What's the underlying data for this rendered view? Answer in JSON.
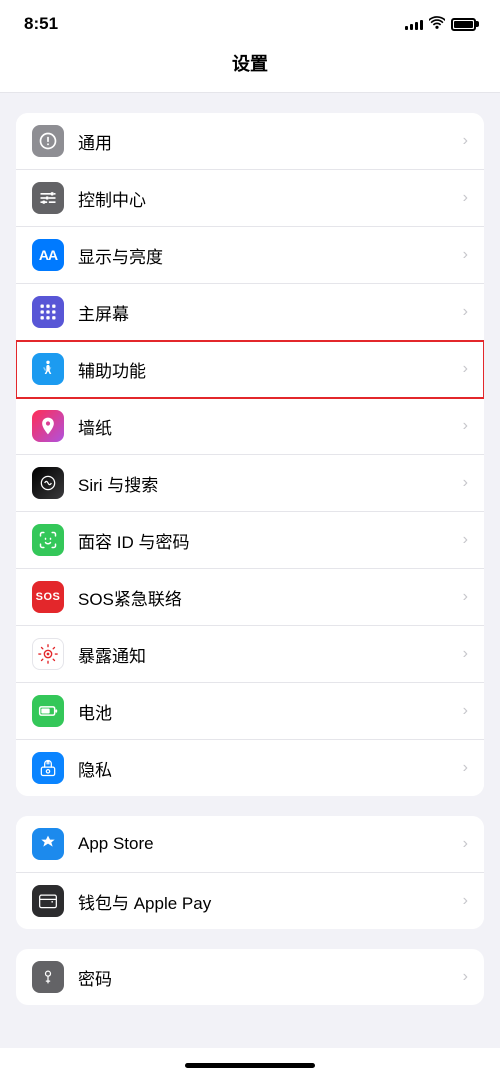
{
  "statusBar": {
    "time": "8:51",
    "signalBars": [
      4,
      6,
      8,
      10,
      12
    ],
    "batteryFull": true
  },
  "header": {
    "title": "设置"
  },
  "sections": [
    {
      "id": "section1",
      "rows": [
        {
          "id": "general",
          "label": "通用",
          "iconBg": "icon-gray",
          "icon": "gear"
        },
        {
          "id": "control-center",
          "label": "控制中心",
          "iconBg": "icon-gray2",
          "icon": "sliders"
        },
        {
          "id": "display",
          "label": "显示与亮度",
          "iconBg": "icon-blue",
          "icon": "aa"
        },
        {
          "id": "home-screen",
          "label": "主屏幕",
          "iconBg": "icon-purple",
          "icon": "grid"
        },
        {
          "id": "accessibility",
          "label": "辅助功能",
          "iconBg": "icon-blue2",
          "icon": "accessibility",
          "highlighted": true
        },
        {
          "id": "wallpaper",
          "label": "墙纸",
          "iconBg": "icon-pink",
          "icon": "flower"
        },
        {
          "id": "siri",
          "label": "Siri 与搜索",
          "iconBg": "icon-gray",
          "icon": "siri"
        },
        {
          "id": "faceid",
          "label": "面容 ID 与密码",
          "iconBg": "icon-green",
          "icon": "faceid"
        },
        {
          "id": "sos",
          "label": "SOS紧急联络",
          "iconBg": "icon-red",
          "icon": "sos"
        },
        {
          "id": "exposure",
          "label": "暴露通知",
          "iconBg": "icon-red",
          "icon": "exposure"
        },
        {
          "id": "battery",
          "label": "电池",
          "iconBg": "icon-green",
          "icon": "battery"
        },
        {
          "id": "privacy",
          "label": "隐私",
          "iconBg": "icon-blue3",
          "icon": "hand"
        }
      ]
    },
    {
      "id": "section2",
      "rows": [
        {
          "id": "appstore",
          "label": "App Store",
          "iconBg": "icon-appstore",
          "icon": "appstore"
        },
        {
          "id": "wallet",
          "label": "钱包与 Apple Pay",
          "iconBg": "icon-wallet",
          "icon": "wallet"
        }
      ]
    },
    {
      "id": "section3",
      "rows": [
        {
          "id": "password",
          "label": "密码",
          "iconBg": "icon-gray2",
          "icon": "key"
        }
      ]
    }
  ]
}
